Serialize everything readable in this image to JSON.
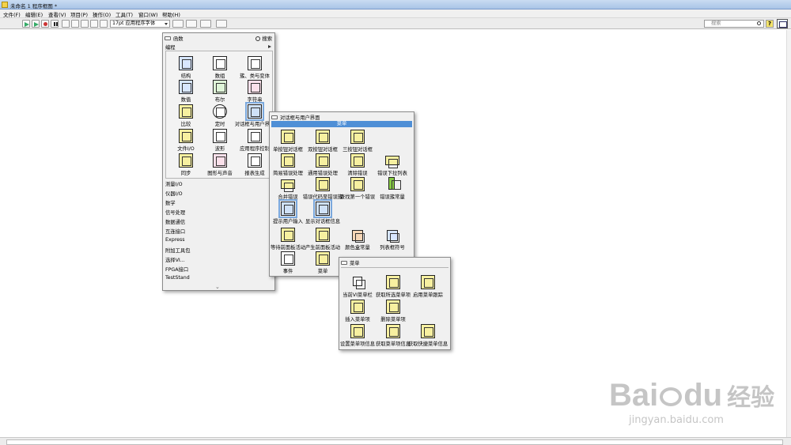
{
  "window": {
    "title": "未命名 1 程序框图 *"
  },
  "menu": [
    "文件(F)",
    "编辑(E)",
    "查看(V)",
    "项目(P)",
    "操作(O)",
    "工具(T)",
    "窗口(W)",
    "帮助(H)"
  ],
  "toolbar": {
    "font": "17pt 应用程序字体",
    "search_placeholder": "搜索",
    "help": "?"
  },
  "functions_palette": {
    "title": "函数",
    "search_label": "搜索",
    "category": "编程",
    "icons": [
      {
        "label": "结构",
        "icon": "structures-icon"
      },
      {
        "label": "数组",
        "icon": "array-icon"
      },
      {
        "label": "簇、类与变体",
        "icon": "cluster-icon"
      },
      {
        "label": "数值",
        "icon": "numeric-icon"
      },
      {
        "label": "布尔",
        "icon": "boolean-icon"
      },
      {
        "label": "字符串",
        "icon": "string-icon"
      },
      {
        "label": "比较",
        "icon": "comparison-icon"
      },
      {
        "label": "定时",
        "icon": "timing-icon"
      },
      {
        "label": "对话框与用户界面",
        "icon": "dialog-ui-icon"
      },
      {
        "label": "文件I/O",
        "icon": "file-io-icon"
      },
      {
        "label": "波形",
        "icon": "waveform-icon"
      },
      {
        "label": "应用程序控制",
        "icon": "app-control-icon"
      },
      {
        "label": "同步",
        "icon": "sync-icon"
      },
      {
        "label": "图形与声音",
        "icon": "graphics-sound-icon"
      },
      {
        "label": "报表生成",
        "icon": "report-icon"
      }
    ],
    "list": [
      "测量I/O",
      "仪器I/O",
      "数学",
      "信号处理",
      "数据通信",
      "互连接口",
      "Express",
      "附加工具包",
      "选择VI...",
      "FPGA接口",
      "TestStand"
    ]
  },
  "dialog_palette": {
    "title": "对话框与用户界面",
    "header": "菜单",
    "icons": [
      {
        "label": "单按钮对话框",
        "icon": "one-button-dialog-icon"
      },
      {
        "label": "双按钮对话框",
        "icon": "two-button-dialog-icon"
      },
      {
        "label": "三按钮对话框",
        "icon": "three-button-dialog-icon"
      },
      {
        "label": "简易错误处理",
        "icon": "simple-error-icon"
      },
      {
        "label": "通用错误处理",
        "icon": "general-error-icon"
      },
      {
        "label": "清除错误",
        "icon": "clear-errors-icon"
      },
      {
        "label": "错误下拉列表",
        "icon": "error-ring-icon"
      },
      {
        "label": "合并错误",
        "icon": "merge-errors-icon"
      },
      {
        "label": "错误代码至错误簇",
        "icon": "error-code-cluster-icon"
      },
      {
        "label": "查找第一个错误",
        "icon": "find-first-error-icon"
      },
      {
        "label": "错误簇常量",
        "icon": "error-cluster-constant-icon"
      },
      {
        "label": "提示用户输入",
        "icon": "prompt-user-icon"
      },
      {
        "label": "显示对话框信息",
        "icon": "display-message-icon"
      },
      {
        "label": "等待前面板活动",
        "icon": "wait-fp-activity-icon"
      },
      {
        "label": "产生前面板活动",
        "icon": "generate-fp-activity-icon"
      },
      {
        "label": "颜色盒常量",
        "icon": "color-box-icon"
      },
      {
        "label": "列表框符号",
        "icon": "listbox-symbol-icon"
      },
      {
        "label": "事件",
        "icon": "events-icon"
      },
      {
        "label": "菜单",
        "icon": "menu-icon"
      }
    ]
  },
  "menu_palette": {
    "title": "菜单",
    "icons": [
      {
        "label": "当前VI菜单栏",
        "icon": "current-vi-menubar-icon"
      },
      {
        "label": "获取所选菜单项",
        "icon": "get-menu-selection-icon"
      },
      {
        "label": "启用菜单跟踪",
        "icon": "enable-menu-tracking-icon"
      },
      {
        "label": "插入菜单项",
        "icon": "insert-menu-items-icon"
      },
      {
        "label": "删除菜单项",
        "icon": "delete-menu-items-icon"
      },
      {
        "label": "设置菜单项信息",
        "icon": "set-menu-item-info-icon"
      },
      {
        "label": "获取菜单项信息",
        "icon": "get-menu-item-info-icon"
      },
      {
        "label": "获取快捷菜单信息",
        "icon": "get-shortcut-menu-icon"
      }
    ]
  },
  "watermark": {
    "brand": "Bai",
    "brand2": "du",
    "cn": "经验",
    "url": "jingyan.baidu.com"
  }
}
